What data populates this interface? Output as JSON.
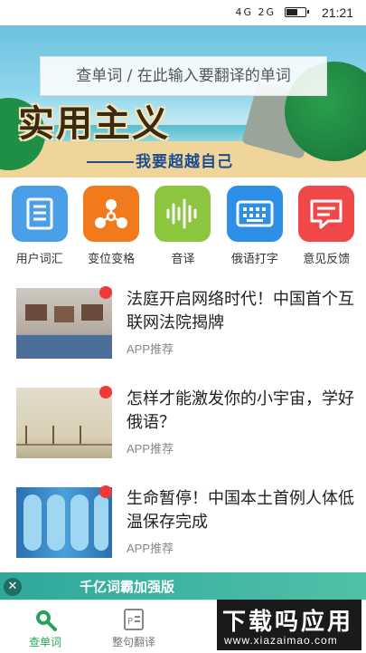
{
  "status_bar": {
    "time": "21:21",
    "network": "4G 2G"
  },
  "search": {
    "placeholder": "查单词 / 在此输入要翻译的单词"
  },
  "banner": {
    "title": "实用主义",
    "subtitle": "我要超越自己"
  },
  "features": [
    {
      "label": "用户词汇",
      "icon": "notebook-icon",
      "color": "#4a9fe8"
    },
    {
      "label": "变位变格",
      "icon": "share-nodes-icon",
      "color": "#f07a1c"
    },
    {
      "label": "音译",
      "icon": "waveform-icon",
      "color": "#8cc63e"
    },
    {
      "label": "俄语打字",
      "icon": "keyboard-icon",
      "color": "#2d8fe6"
    },
    {
      "label": "意见反馈",
      "icon": "chat-bubble-icon",
      "color": "#f04848"
    }
  ],
  "news": [
    {
      "title": "法庭开启网络时代！中国首个互联网法院揭牌",
      "tag": "APP推荐"
    },
    {
      "title": "怎样才能激发你的小宇宙，学好俄语？",
      "tag": "APP推荐"
    },
    {
      "title": "生命暂停！中国本土首例人体低温保存完成",
      "tag": "APP推荐"
    }
  ],
  "ad_banner": {
    "text": "千亿词霸加强版",
    "close": "✕"
  },
  "tabs": [
    {
      "label": "查单词",
      "active": true,
      "color": "#2aa35a"
    },
    {
      "label": "整句翻译",
      "active": false,
      "color": "#777777"
    }
  ],
  "watermark": {
    "title": "下载吗应用",
    "url": "www.xiazaimao.com"
  }
}
